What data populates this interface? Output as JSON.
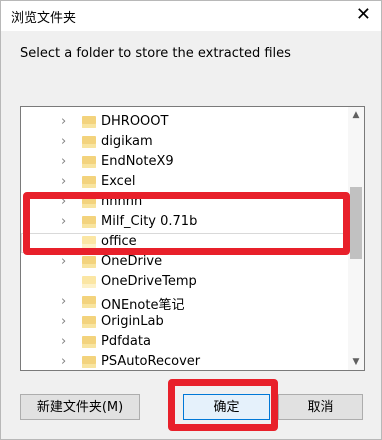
{
  "window": {
    "title": "浏览文件夹"
  },
  "prompt": "Select a folder to store the extracted files",
  "tree": {
    "items": [
      {
        "label": "DHROOOT"
      },
      {
        "label": "digikam"
      },
      {
        "label": "EndNoteX9"
      },
      {
        "label": "Excel"
      },
      {
        "label": "hhhhh"
      },
      {
        "label": "Milf_City 0.71b"
      },
      {
        "label": "office",
        "selected": true
      },
      {
        "label": "OneDrive"
      },
      {
        "label": "OneDriveTemp"
      },
      {
        "label": "ONEnote笔记"
      },
      {
        "label": "OriginLab"
      },
      {
        "label": "Pdfdata"
      },
      {
        "label": "PSAutoRecover"
      }
    ]
  },
  "buttons": {
    "new_folder": "新建文件夹(M)",
    "ok": "确定",
    "cancel": "取消"
  },
  "icons": {
    "close": "close-icon",
    "chevron": "chevron-right-icon",
    "folder": "folder-icon"
  },
  "colors": {
    "highlight": "#e8202a",
    "folder": "#f3d37d",
    "primary_border": "#0078d7"
  }
}
